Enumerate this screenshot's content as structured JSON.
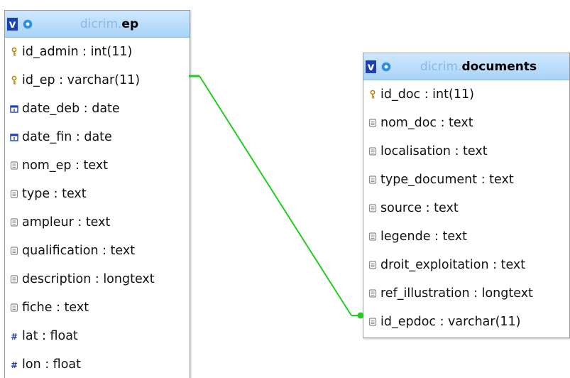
{
  "colors": {
    "header_gradient_top": "#cfe8ff",
    "header_gradient_bottom": "#a9d3f7",
    "schema_text": "#8bb8e8",
    "toggle_bg": "#1c3fb3",
    "relation_line": "#22cc22",
    "key_icon": "#b8860b",
    "date_icon": "#1c3fb3",
    "text_icon": "#8a8a8a",
    "numeric_icon": "#1c3fb3"
  },
  "tables": {
    "ep": {
      "toggle_label": "v",
      "schema": "dicrim.",
      "name": "ep",
      "columns": [
        {
          "label": "id_admin : int(11)",
          "icon": "key-icon"
        },
        {
          "label": "id_ep : varchar(11)",
          "icon": "key-icon"
        },
        {
          "label": "date_deb : date",
          "icon": "date-icon"
        },
        {
          "label": "date_fin : date",
          "icon": "date-icon"
        },
        {
          "label": "nom_ep : text",
          "icon": "text-field-icon"
        },
        {
          "label": "type : text",
          "icon": "text-field-icon"
        },
        {
          "label": "ampleur : text",
          "icon": "text-field-icon"
        },
        {
          "label": "qualification : text",
          "icon": "text-field-icon"
        },
        {
          "label": "description : longtext",
          "icon": "text-field-icon"
        },
        {
          "label": "fiche : text",
          "icon": "text-field-icon"
        },
        {
          "label": "lat : float",
          "icon": "numeric-icon"
        },
        {
          "label": "lon : float",
          "icon": "numeric-icon"
        }
      ]
    },
    "documents": {
      "toggle_label": "v",
      "schema": "dicrim.",
      "name": "documents",
      "columns": [
        {
          "label": "id_doc : int(11)",
          "icon": "key-icon"
        },
        {
          "label": "nom_doc : text",
          "icon": "text-field-icon"
        },
        {
          "label": "localisation : text",
          "icon": "text-field-icon"
        },
        {
          "label": "type_document : text",
          "icon": "text-field-icon"
        },
        {
          "label": "source : text",
          "icon": "text-field-icon"
        },
        {
          "label": "legende : text",
          "icon": "text-field-icon"
        },
        {
          "label": "droit_exploitation : text",
          "icon": "text-field-icon"
        },
        {
          "label": "ref_illustration : longtext",
          "icon": "text-field-icon"
        },
        {
          "label": "id_epdoc : varchar(11)",
          "icon": "text-field-icon"
        }
      ]
    }
  },
  "relations": [
    {
      "from_table": "ep",
      "from_column": "id_ep",
      "to_table": "documents",
      "to_column": "id_epdoc"
    }
  ]
}
